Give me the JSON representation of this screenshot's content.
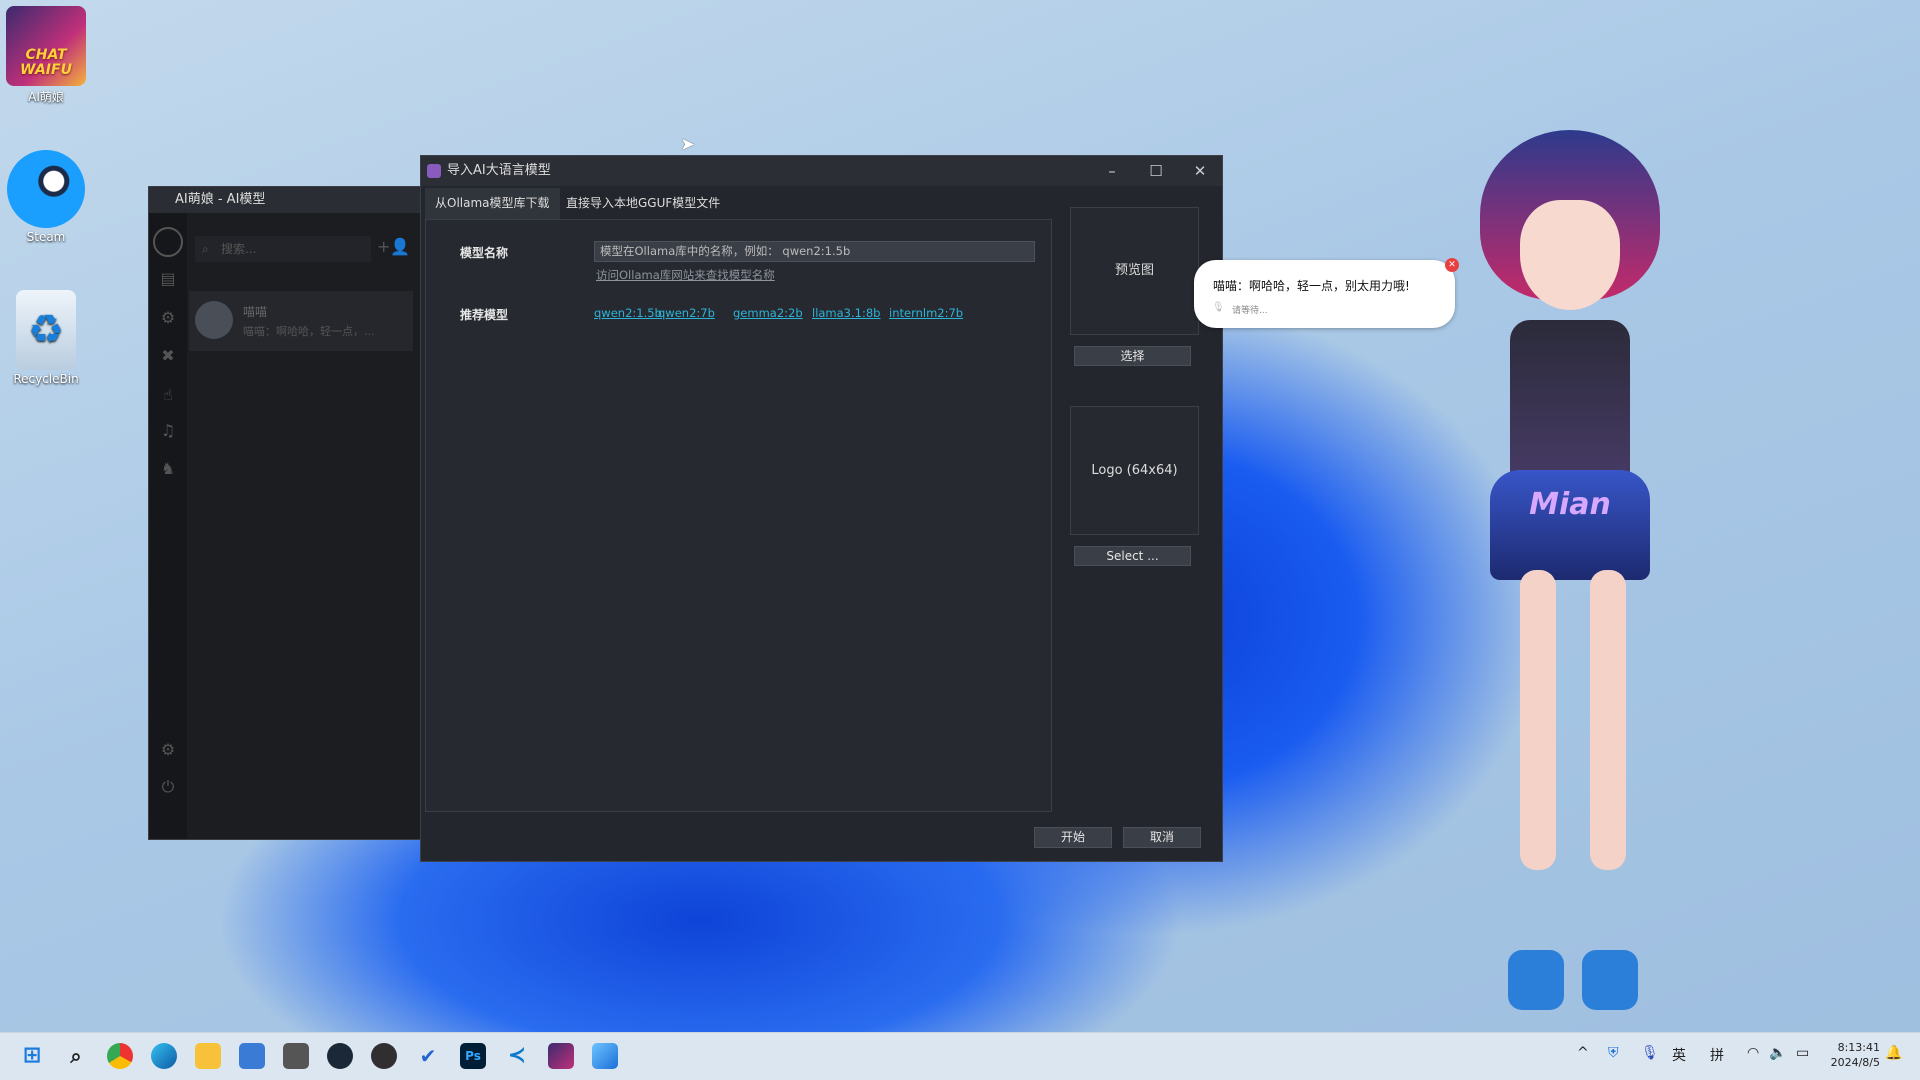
{
  "desktop": {
    "icons": [
      {
        "label": "AI萌娘",
        "overlay": "CHAT WAIFU"
      },
      {
        "label": "Steam"
      },
      {
        "label": "RecycleBin"
      }
    ]
  },
  "back_window": {
    "title": "AI萌娘 - AI模型",
    "search_placeholder": "搜索...",
    "contact": {
      "name": "喵喵",
      "preview": "喵喵：啊哈哈，轻一点，..."
    }
  },
  "dialog": {
    "title": "导入AI大语言模型",
    "tabs": [
      {
        "label": "从Ollama模型库下载",
        "active": true
      },
      {
        "label": "直接导入本地GGUF模型文件",
        "active": false
      }
    ],
    "model_name_label": "模型名称",
    "model_name_placeholder": "模型在Ollama库中的名称，例如： qwen2:1.5b",
    "visit_link": "访问Ollama库网站来查找模型名称",
    "recommended_label": "推荐模型",
    "recommended": [
      "qwen2:1.5b",
      "qwen2:7b",
      "gemma2:2b",
      "llama3.1:8b",
      "internlm2:7b"
    ],
    "preview_label": "预览图",
    "preview_button": "选择",
    "logo_label": "Logo (64x64)",
    "logo_button": "Select ...",
    "start_button": "开始",
    "cancel_button": "取消"
  },
  "bubble": {
    "message": "喵喵：啊哈哈，轻一点，别太用力哦!",
    "status": "请等待..."
  },
  "character_text": "Mian",
  "taskbar": {
    "apps": [
      "start",
      "search",
      "chrome",
      "edge",
      "file-explorer",
      "notepad",
      "calculator",
      "steam",
      "obs",
      "todo",
      "photoshop",
      "vscode",
      "ai-waifu",
      "photos"
    ],
    "ps_label": "Ps",
    "tray": {
      "ime_lang": "英",
      "ime_mode": "拼",
      "time": "8:13:41",
      "date": "2024/8/5"
    }
  }
}
